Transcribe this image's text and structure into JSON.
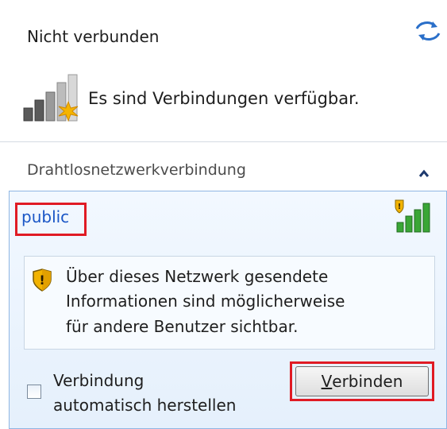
{
  "header": {
    "status_title": "Nicht verbunden",
    "availability_text": "Es sind Verbindungen verfügbar.",
    "refresh_icon": "refresh-icon",
    "status_icon": "signal-bars-no-connection-icon"
  },
  "section": {
    "title": "Drahtlosnetzwerkverbindung",
    "collapse_icon": "chevron-up-icon"
  },
  "network": {
    "ssid": "public",
    "signal_icon": "signal-bars-unsecured-icon",
    "warning": {
      "icon": "shield-warning-icon",
      "line1": "Über dieses Netzwerk gesendete",
      "line2": "Informationen sind möglicherweise",
      "line3": "für andere Benutzer sichtbar."
    },
    "auto_connect": {
      "line1": "Verbindung",
      "line2": "automatisch herstellen",
      "checked": false
    },
    "connect_button": {
      "mnemonic": "V",
      "rest": "erbinden"
    }
  },
  "colors": {
    "highlight_outline": "#e01b24",
    "ssid_link": "#1a56c6",
    "tile_border": "#8fb6e3"
  }
}
